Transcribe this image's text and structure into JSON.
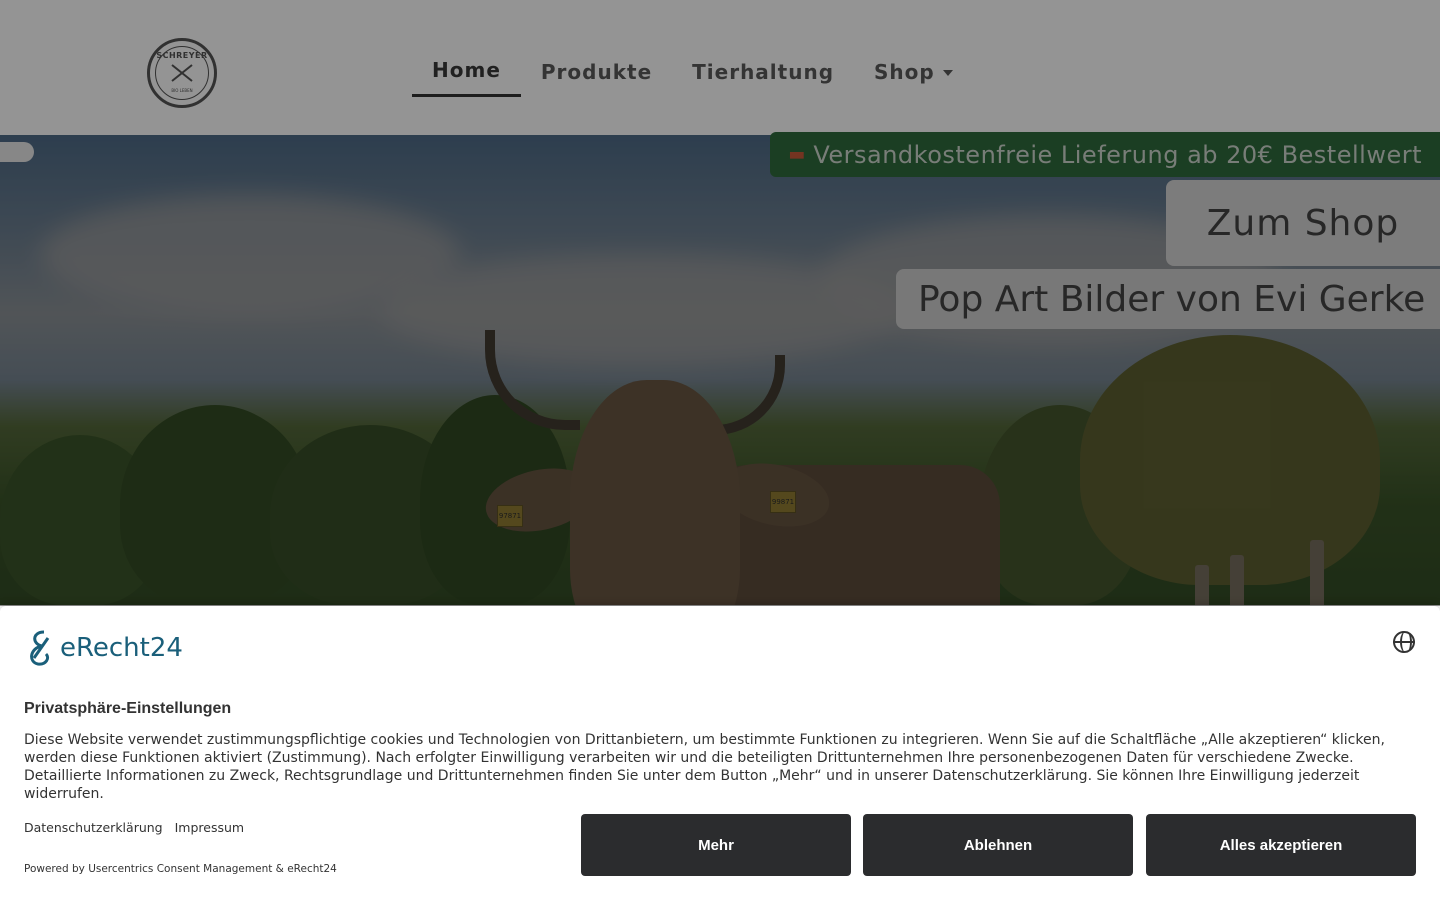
{
  "header": {
    "logo": {
      "brand": "SCHREYER",
      "subtext": "BIO LEBEN",
      "icon": "farm-logo-icon"
    },
    "nav": [
      {
        "label": "Home",
        "active": true
      },
      {
        "label": "Produkte",
        "active": false
      },
      {
        "label": "Tierhaltung",
        "active": false
      },
      {
        "label": "Shop",
        "active": false,
        "has_dropdown": true
      }
    ]
  },
  "hero": {
    "shipping_icon": "truck-icon",
    "shipping_text": "Versandkostenfreie Lieferung ab 20€ Bestellwert",
    "shop_button": "Zum Shop",
    "popart_text": "Pop Art Bilder von Evi Gerke",
    "ear_tags": [
      "97871",
      "99871"
    ]
  },
  "consent": {
    "brand": "eRecht24",
    "language_icon": "globe-icon",
    "title": "Privatsphäre-Einstellungen",
    "description": "Diese Website verwendet zustimmungspflichtige cookies und Technologien von Drittanbietern, um bestimmte Funktionen zu integrieren. Wenn Sie auf die Schaltfläche „Alle akzeptieren“ klicken, werden diese Funktionen aktiviert (Zustimmung). Nach erfolgter Einwilligung verarbeiten wir und die beteiligten Drittunternehmen Ihre personenbezogenen Daten für verschiedene Zwecke. Detaillierte Informationen zu Zweck, Rechtsgrundlage und Drittunternehmen finden Sie unter dem Button „Mehr“ und in unserer Datenschutzerklärung. Sie können Ihre Einwilligung jederzeit widerrufen.",
    "links": {
      "privacy": "Datenschutzerklärung",
      "imprint": "Impressum"
    },
    "powered_by": "Powered by Usercentrics Consent Management & eRecht24",
    "buttons": {
      "more": "Mehr",
      "decline": "Ablehnen",
      "accept_all": "Alles akzeptieren"
    }
  },
  "colors": {
    "shipping_badge": "#2f6b3d",
    "button_dark": "#2b2c2e",
    "brand_teal": "#1a5f7a"
  }
}
